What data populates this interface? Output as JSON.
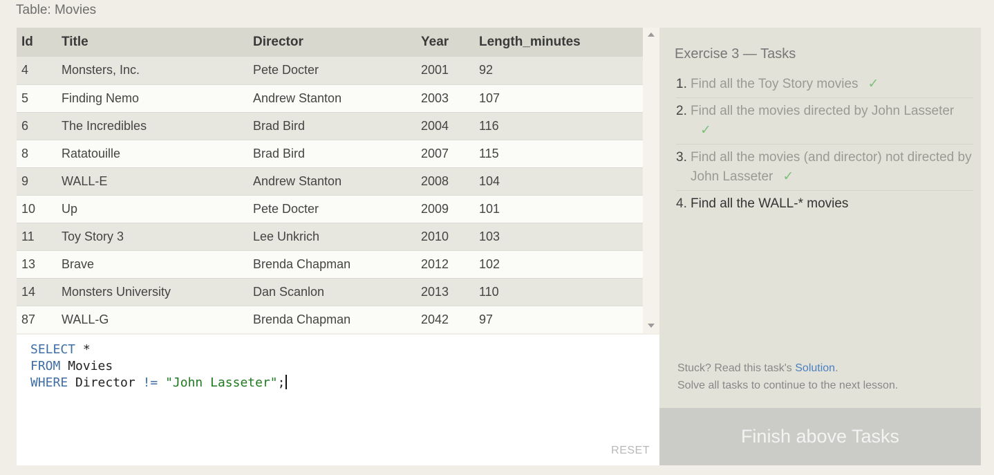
{
  "table_caption": "Table: Movies",
  "table": {
    "columns": [
      "Id",
      "Title",
      "Director",
      "Year",
      "Length_minutes"
    ],
    "rows": [
      [
        "4",
        "Monsters, Inc.",
        "Pete Docter",
        "2001",
        "92"
      ],
      [
        "5",
        "Finding Nemo",
        "Andrew Stanton",
        "2003",
        "107"
      ],
      [
        "6",
        "The Incredibles",
        "Brad Bird",
        "2004",
        "116"
      ],
      [
        "8",
        "Ratatouille",
        "Brad Bird",
        "2007",
        "115"
      ],
      [
        "9",
        "WALL-E",
        "Andrew Stanton",
        "2008",
        "104"
      ],
      [
        "10",
        "Up",
        "Pete Docter",
        "2009",
        "101"
      ],
      [
        "11",
        "Toy Story 3",
        "Lee Unkrich",
        "2010",
        "103"
      ],
      [
        "13",
        "Brave",
        "Brenda Chapman",
        "2012",
        "102"
      ],
      [
        "14",
        "Monsters University",
        "Dan Scanlon",
        "2013",
        "110"
      ],
      [
        "87",
        "WALL-G",
        "Brenda Chapman",
        "2042",
        "97"
      ]
    ]
  },
  "editor": {
    "line1_kw": "SELECT",
    "line1_rest": " *",
    "line2_kw": "FROM",
    "line2_rest": " Movies",
    "line3_kw": "WHERE",
    "line3_mid": " Director ",
    "line3_op": "!=",
    "line3_str": " \"John Lasseter\"",
    "line3_end": ";",
    "reset_label": "RESET"
  },
  "tasks": {
    "title": "Exercise 3 — Tasks",
    "items": [
      {
        "num": "1.",
        "text": "Find all the Toy Story movies",
        "check": "✓"
      },
      {
        "num": "2.",
        "text": "Find all the movies directed by John Lasseter",
        "check": "✓"
      },
      {
        "num": "3.",
        "text": "Find all the movies (and director) not directed by John Lasseter",
        "check": "✓"
      },
      {
        "num": "4.",
        "text": "Find all the WALL-* movies",
        "check": ""
      }
    ],
    "help_prefix": "Stuck? Read this task's ",
    "help_link": "Solution",
    "help_suffix": ".",
    "help_line2": "Solve all tasks to continue to the next lesson."
  },
  "finish_button": "Finish above Tasks",
  "colors": {
    "keyword": "#3e6ea5",
    "string": "#1f7a1f",
    "check": "#7cc07c",
    "link": "#4a7fc1"
  }
}
